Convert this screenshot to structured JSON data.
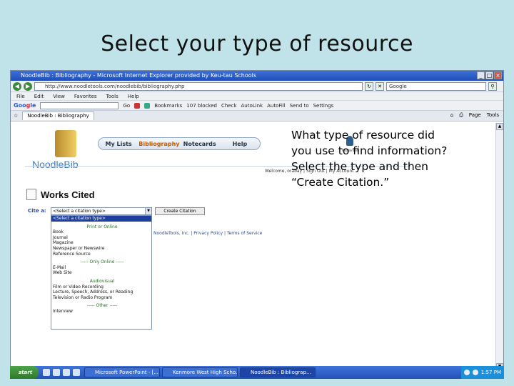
{
  "slide": {
    "title": "Select your type of resource"
  },
  "browser": {
    "window_title": "NoodleBib : Bibliography - Microsoft Internet Explorer provided by Keu-tau Schools",
    "url": "http://www.noodletools.com/noodlebib/bibliography.php",
    "search_value": "Google",
    "menu": [
      "File",
      "Edit",
      "View",
      "Favorites",
      "Tools",
      "Help"
    ],
    "toolbar": {
      "go_label": "Go",
      "bookmarks": "Bookmarks",
      "blocked": "107 blocked",
      "check": "Check",
      "autolink": "AutoLink",
      "autofill": "AutoFill",
      "send_to": "Send to",
      "settings": "Settings"
    },
    "tab_label": "NoodleBib : Bibliography",
    "tab_tools": [
      "Page",
      "Tools"
    ]
  },
  "app": {
    "logo": "NoodleBib",
    "nav": [
      "My Lists",
      "Bibliography",
      "Notecards",
      "Help"
    ],
    "nav_active": "Bibliography",
    "brand_label": "NoodleTools",
    "welcome": "Welcome, orabay | Sign Out | My Account",
    "section_title": "Works Cited",
    "cite_label": "Cite a:",
    "select_value": "<Select a citation type>",
    "create_button": "Create Citation",
    "footer": "NoodleTools, Inc. | Privacy Policy | Terms of Service",
    "dropdown_items": [
      {
        "label": "<Select a citation type>",
        "kind": "selected"
      },
      {
        "label": "",
        "kind": "blank"
      },
      {
        "label": "Print or Online",
        "kind": "group"
      },
      {
        "label": "Book",
        "kind": "item"
      },
      {
        "label": "Journal",
        "kind": "item"
      },
      {
        "label": "Magazine",
        "kind": "item"
      },
      {
        "label": "Newspaper or Newswire",
        "kind": "item"
      },
      {
        "label": "Reference Source",
        "kind": "item"
      },
      {
        "label": "",
        "kind": "blank"
      },
      {
        "label": "----- Only Online -----",
        "kind": "group"
      },
      {
        "label": "E-Mail",
        "kind": "item"
      },
      {
        "label": "Web Site",
        "kind": "item"
      },
      {
        "label": "",
        "kind": "blank"
      },
      {
        "label": "Audiovisual",
        "kind": "group"
      },
      {
        "label": "Film or Video Recording",
        "kind": "item"
      },
      {
        "label": "Lecture, Speech, Address, or Reading",
        "kind": "item"
      },
      {
        "label": "Television or Radio Program",
        "kind": "item"
      },
      {
        "label": "",
        "kind": "blank"
      },
      {
        "label": "----- Other -----",
        "kind": "group"
      },
      {
        "label": "Interview",
        "kind": "item"
      }
    ]
  },
  "note": "What type of resource did you use to find information?  Select the type and then “Create Citation.”",
  "taskbar": {
    "start": "start",
    "tasks": [
      "Microsoft PowerPoint - [...",
      "Kenmore West High Scho...",
      "NoodleBib : Bibliograp..."
    ],
    "active_task": 2,
    "clock": "1:57 PM"
  }
}
